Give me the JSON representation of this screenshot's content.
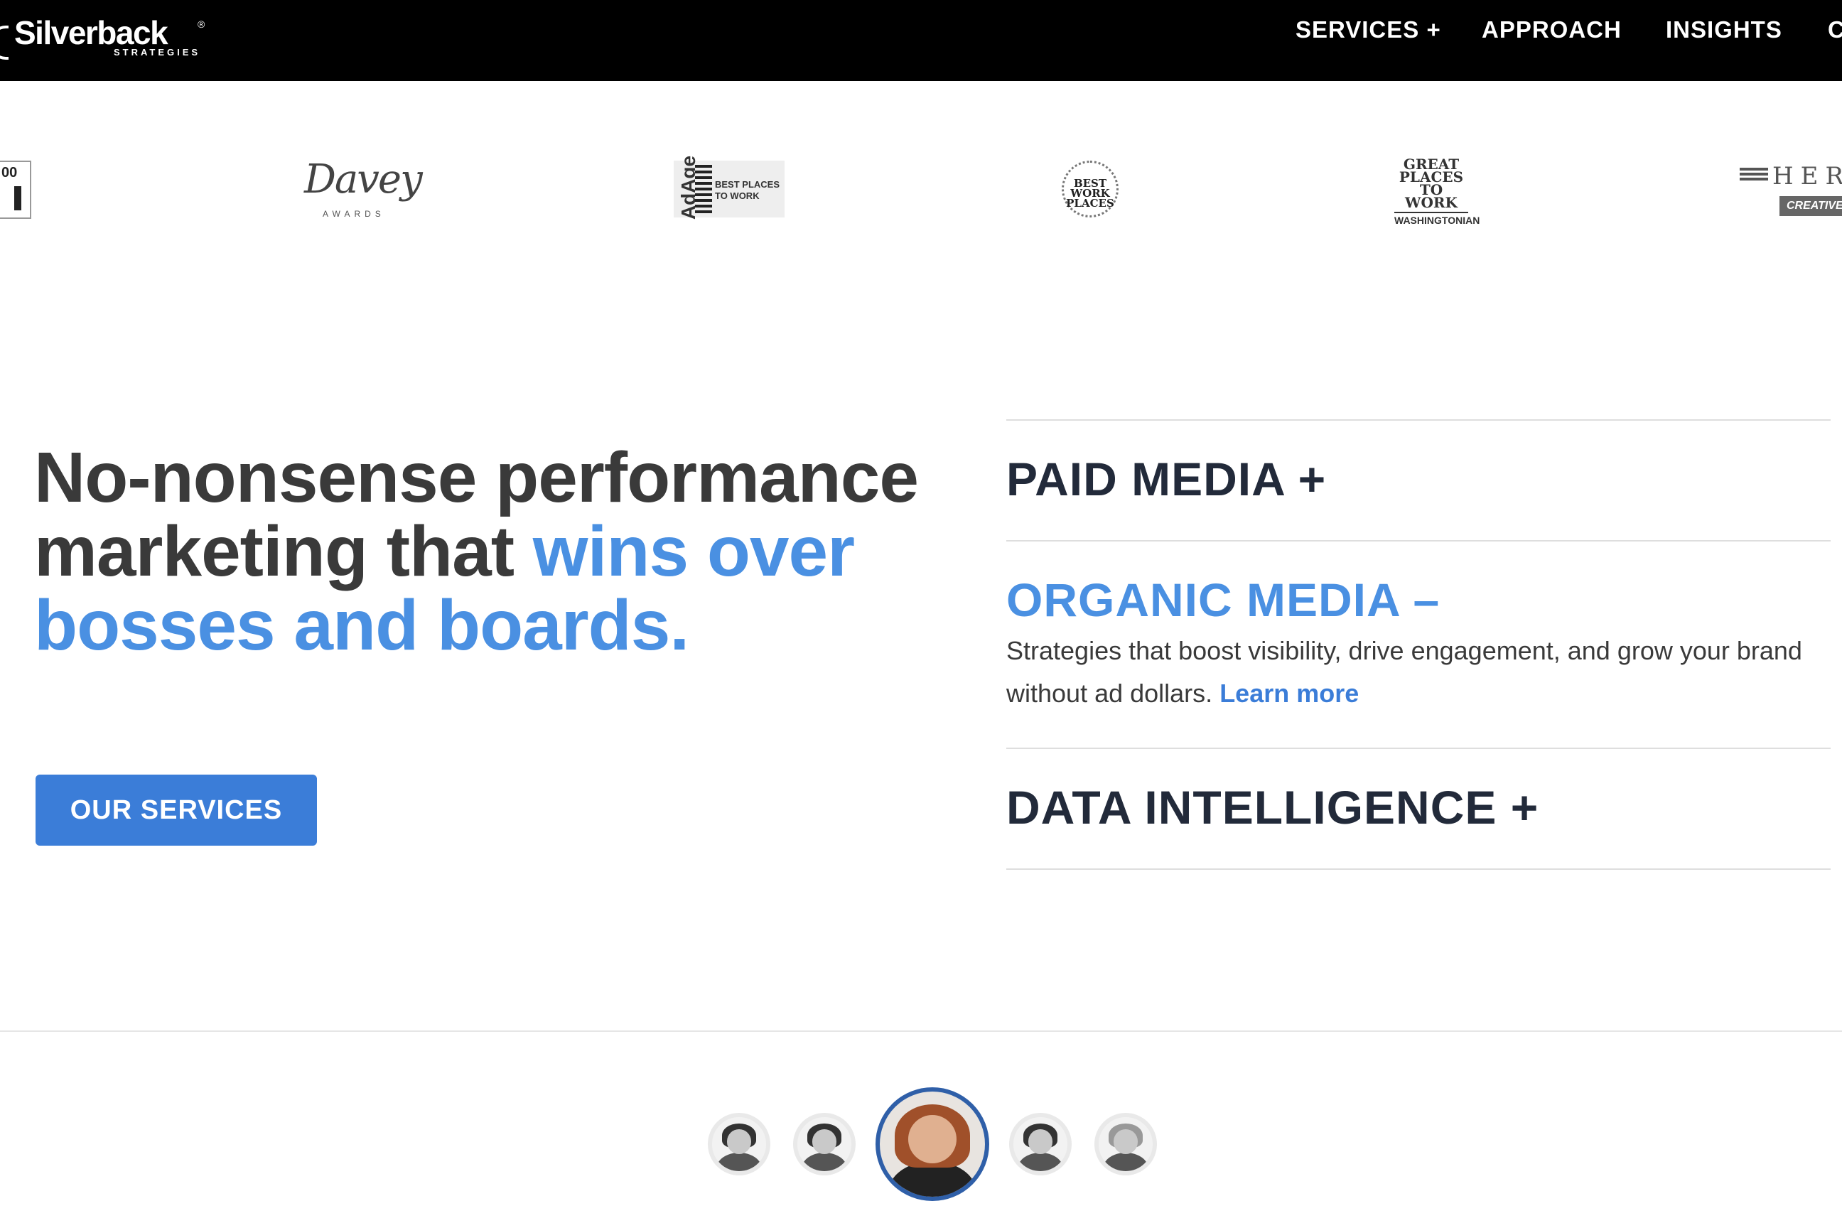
{
  "nav": {
    "logo_text": "Silverback",
    "logo_subtext": "STRATEGIES",
    "logo_tm": "®",
    "items": [
      {
        "label": "SERVICES +"
      },
      {
        "label": "APPROACH"
      },
      {
        "label": "INSIGHTS"
      },
      {
        "label": "C"
      }
    ]
  },
  "awards": {
    "inc_text": "00",
    "davey": {
      "title": "Davey",
      "sub": "AWARDS"
    },
    "adage": {
      "vertical": "AdAge",
      "text": "BEST PLACES TO WORK"
    },
    "best_work_places": {
      "text": "BEST WORK PLACES"
    },
    "great_places": {
      "title": "GREAT PLACES TO WORK",
      "sub": "WASHINGTONIAN"
    },
    "hermes": {
      "title": "HER",
      "sub": "CREATIVE A"
    }
  },
  "hero": {
    "title_part1": "No-nonsense performance marketing that ",
    "title_highlight": "wins over bosses and boards.",
    "cta_label": "OUR SERVICES"
  },
  "services": [
    {
      "title": "PAID MEDIA +"
    },
    {
      "title": "ORGANIC MEDIA –",
      "description": "Strategies that boost visibility, drive engagement, and grow your brand without ad dollars.",
      "link_label": "Learn more"
    },
    {
      "title": "DATA INTELLIGENCE +"
    }
  ],
  "colors": {
    "accent": "#4a90e2",
    "button": "#3b7dd8",
    "heading_dark": "#222a3a",
    "nav_bg": "#000000"
  }
}
